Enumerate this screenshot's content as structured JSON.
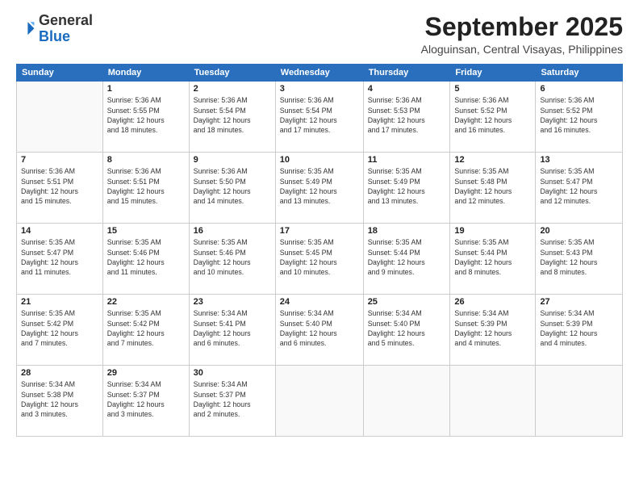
{
  "header": {
    "logo": {
      "general": "General",
      "blue": "Blue"
    },
    "title": "September 2025",
    "location": "Aloguinsan, Central Visayas, Philippines"
  },
  "calendar": {
    "days_of_week": [
      "Sunday",
      "Monday",
      "Tuesday",
      "Wednesday",
      "Thursday",
      "Friday",
      "Saturday"
    ],
    "weeks": [
      [
        {
          "day": "",
          "info": ""
        },
        {
          "day": "1",
          "info": "Sunrise: 5:36 AM\nSunset: 5:55 PM\nDaylight: 12 hours\nand 18 minutes."
        },
        {
          "day": "2",
          "info": "Sunrise: 5:36 AM\nSunset: 5:54 PM\nDaylight: 12 hours\nand 18 minutes."
        },
        {
          "day": "3",
          "info": "Sunrise: 5:36 AM\nSunset: 5:54 PM\nDaylight: 12 hours\nand 17 minutes."
        },
        {
          "day": "4",
          "info": "Sunrise: 5:36 AM\nSunset: 5:53 PM\nDaylight: 12 hours\nand 17 minutes."
        },
        {
          "day": "5",
          "info": "Sunrise: 5:36 AM\nSunset: 5:52 PM\nDaylight: 12 hours\nand 16 minutes."
        },
        {
          "day": "6",
          "info": "Sunrise: 5:36 AM\nSunset: 5:52 PM\nDaylight: 12 hours\nand 16 minutes."
        }
      ],
      [
        {
          "day": "7",
          "info": "Sunrise: 5:36 AM\nSunset: 5:51 PM\nDaylight: 12 hours\nand 15 minutes."
        },
        {
          "day": "8",
          "info": "Sunrise: 5:36 AM\nSunset: 5:51 PM\nDaylight: 12 hours\nand 15 minutes."
        },
        {
          "day": "9",
          "info": "Sunrise: 5:36 AM\nSunset: 5:50 PM\nDaylight: 12 hours\nand 14 minutes."
        },
        {
          "day": "10",
          "info": "Sunrise: 5:35 AM\nSunset: 5:49 PM\nDaylight: 12 hours\nand 13 minutes."
        },
        {
          "day": "11",
          "info": "Sunrise: 5:35 AM\nSunset: 5:49 PM\nDaylight: 12 hours\nand 13 minutes."
        },
        {
          "day": "12",
          "info": "Sunrise: 5:35 AM\nSunset: 5:48 PM\nDaylight: 12 hours\nand 12 minutes."
        },
        {
          "day": "13",
          "info": "Sunrise: 5:35 AM\nSunset: 5:47 PM\nDaylight: 12 hours\nand 12 minutes."
        }
      ],
      [
        {
          "day": "14",
          "info": "Sunrise: 5:35 AM\nSunset: 5:47 PM\nDaylight: 12 hours\nand 11 minutes."
        },
        {
          "day": "15",
          "info": "Sunrise: 5:35 AM\nSunset: 5:46 PM\nDaylight: 12 hours\nand 11 minutes."
        },
        {
          "day": "16",
          "info": "Sunrise: 5:35 AM\nSunset: 5:46 PM\nDaylight: 12 hours\nand 10 minutes."
        },
        {
          "day": "17",
          "info": "Sunrise: 5:35 AM\nSunset: 5:45 PM\nDaylight: 12 hours\nand 10 minutes."
        },
        {
          "day": "18",
          "info": "Sunrise: 5:35 AM\nSunset: 5:44 PM\nDaylight: 12 hours\nand 9 minutes."
        },
        {
          "day": "19",
          "info": "Sunrise: 5:35 AM\nSunset: 5:44 PM\nDaylight: 12 hours\nand 8 minutes."
        },
        {
          "day": "20",
          "info": "Sunrise: 5:35 AM\nSunset: 5:43 PM\nDaylight: 12 hours\nand 8 minutes."
        }
      ],
      [
        {
          "day": "21",
          "info": "Sunrise: 5:35 AM\nSunset: 5:42 PM\nDaylight: 12 hours\nand 7 minutes."
        },
        {
          "day": "22",
          "info": "Sunrise: 5:35 AM\nSunset: 5:42 PM\nDaylight: 12 hours\nand 7 minutes."
        },
        {
          "day": "23",
          "info": "Sunrise: 5:34 AM\nSunset: 5:41 PM\nDaylight: 12 hours\nand 6 minutes."
        },
        {
          "day": "24",
          "info": "Sunrise: 5:34 AM\nSunset: 5:40 PM\nDaylight: 12 hours\nand 6 minutes."
        },
        {
          "day": "25",
          "info": "Sunrise: 5:34 AM\nSunset: 5:40 PM\nDaylight: 12 hours\nand 5 minutes."
        },
        {
          "day": "26",
          "info": "Sunrise: 5:34 AM\nSunset: 5:39 PM\nDaylight: 12 hours\nand 4 minutes."
        },
        {
          "day": "27",
          "info": "Sunrise: 5:34 AM\nSunset: 5:39 PM\nDaylight: 12 hours\nand 4 minutes."
        }
      ],
      [
        {
          "day": "28",
          "info": "Sunrise: 5:34 AM\nSunset: 5:38 PM\nDaylight: 12 hours\nand 3 minutes."
        },
        {
          "day": "29",
          "info": "Sunrise: 5:34 AM\nSunset: 5:37 PM\nDaylight: 12 hours\nand 3 minutes."
        },
        {
          "day": "30",
          "info": "Sunrise: 5:34 AM\nSunset: 5:37 PM\nDaylight: 12 hours\nand 2 minutes."
        },
        {
          "day": "",
          "info": ""
        },
        {
          "day": "",
          "info": ""
        },
        {
          "day": "",
          "info": ""
        },
        {
          "day": "",
          "info": ""
        }
      ]
    ]
  }
}
